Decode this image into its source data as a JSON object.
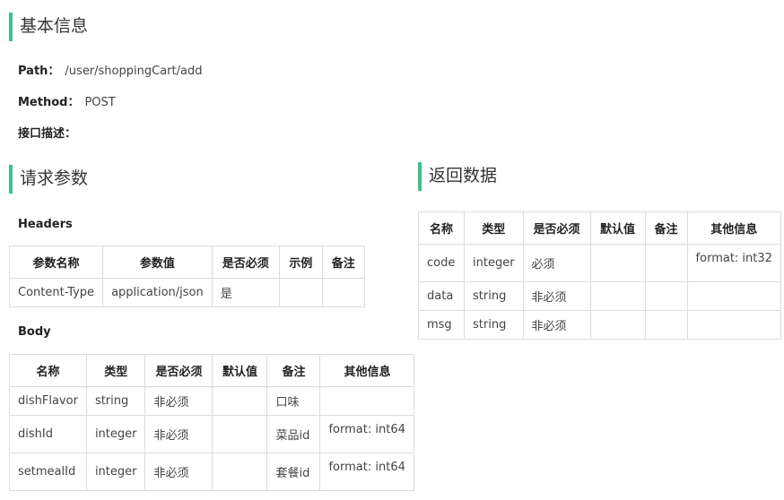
{
  "basic": {
    "title": "基本信息",
    "path_label": "Path：",
    "path_value": "/user/shoppingCart/add",
    "method_label": "Method：",
    "method_value": "POST",
    "desc_label": "接口描述："
  },
  "request": {
    "title": "请求参数",
    "headers_label": "Headers",
    "headers_table": {
      "columns": [
        "参数名称",
        "参数值",
        "是否必须",
        "示例",
        "备注"
      ],
      "rows": [
        [
          "Content-Type",
          "application/json",
          "是",
          "",
          ""
        ]
      ]
    },
    "body_label": "Body",
    "body_table": {
      "columns": [
        "名称",
        "类型",
        "是否必须",
        "默认值",
        "备注",
        "其他信息"
      ],
      "rows": [
        [
          "dishFlavor",
          "string",
          "非必须",
          "",
          "口味",
          ""
        ],
        [
          "dishId",
          "integer",
          "非必须",
          "",
          "菜品id",
          "format: int64"
        ],
        [
          "setmealId",
          "integer",
          "非必须",
          "",
          "套餐id",
          "format: int64"
        ]
      ]
    }
  },
  "response": {
    "title": "返回数据",
    "table": {
      "columns": [
        "名称",
        "类型",
        "是否必须",
        "默认值",
        "备注",
        "其他信息"
      ],
      "rows": [
        [
          "code",
          "integer",
          "必须",
          "",
          "",
          "format: int32"
        ],
        [
          "data",
          "string",
          "非必须",
          "",
          "",
          ""
        ],
        [
          "msg",
          "string",
          "非必须",
          "",
          "",
          ""
        ]
      ]
    }
  },
  "colors": {
    "accent_bar": "#3dbf8a",
    "border": "#dcdcdc"
  }
}
